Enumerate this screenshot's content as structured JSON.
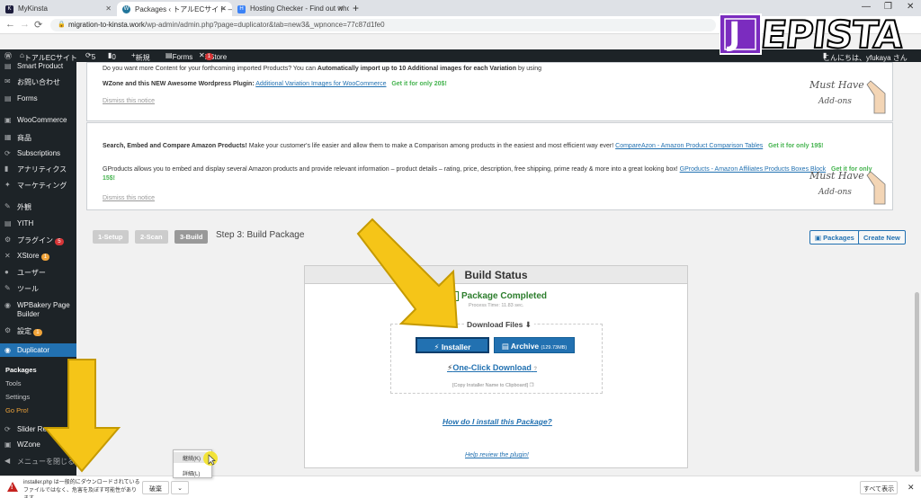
{
  "browser": {
    "tabs": [
      {
        "label": "MyKinsta",
        "fav": "K",
        "fav_color": "#1c1c3c"
      },
      {
        "label": "Packages ‹ トアルECサイト — Wor",
        "fav": "W",
        "fav_color": "#21759b"
      },
      {
        "label": "Hosting Checker - Find out who",
        "fav": "H",
        "fav_color": "#3b82f6"
      }
    ],
    "url_host": "migration-to-kinsta.work",
    "url_path": "/wp-admin/admin.php?page=duplicator&tab=new3&_wpnonce=77c87d1fe0"
  },
  "adminbar": {
    "site": "トアルECサイト",
    "updates": "5",
    "comments": "0",
    "new": "新規",
    "forms": "Forms",
    "xstore": "XStore",
    "xstore_badge": "1",
    "greeting": "こんにちは、yfukaya さん"
  },
  "sidebar": {
    "items": [
      {
        "label": "Smart Product",
        "icon": "▤"
      },
      {
        "label": "お問い合わせ",
        "icon": "✉"
      },
      {
        "label": "Forms",
        "icon": "▤"
      },
      {
        "label": "WooCommerce",
        "icon": "▣"
      },
      {
        "label": "商品",
        "icon": "▦"
      },
      {
        "label": "Subscriptions",
        "icon": "⟳"
      },
      {
        "label": "アナリティクス",
        "icon": "▮"
      },
      {
        "label": "マーケティング",
        "icon": "✦"
      },
      {
        "label": "外観",
        "icon": "✎"
      },
      {
        "label": "YITH",
        "icon": "▤"
      },
      {
        "label": "プラグイン",
        "icon": "⚙",
        "badge": "5"
      },
      {
        "label": "XStore",
        "icon": "✕",
        "badge": "1"
      },
      {
        "label": "ユーザー",
        "icon": "●"
      },
      {
        "label": "ツール",
        "icon": "✎"
      },
      {
        "label": "WPBakery Page",
        "icon": "◉"
      },
      {
        "label": "Builder",
        "icon": ""
      },
      {
        "label": "設定",
        "icon": "⚙",
        "badge": "1"
      },
      {
        "label": "Duplicator",
        "icon": "◉"
      }
    ],
    "sub": [
      "Packages",
      "Tools",
      "Settings",
      "Go Pro!"
    ],
    "bottom": [
      {
        "label": "Slider Revo",
        "icon": "⟳"
      },
      {
        "label": "WZone",
        "icon": "▣"
      },
      {
        "label": "メニューを閉じる",
        "icon": "◀"
      }
    ]
  },
  "notice1": {
    "line1": "Do you want more Content for your forthcoming imported Products? You can",
    "line1_bold": "Automatically import up to 10 Additional images for each Variation",
    "line1_end": "by using",
    "line2_start": "WZone and this NEW Awesome Wordpress Plugin:",
    "line2_link": "Additional Variation Images for WooCommerce",
    "line2_price": "Get it for only 20$!",
    "dismiss": "Dismiss this notice"
  },
  "notice2": {
    "p1_bold": "Search, Embed and Compare Amazon Products!",
    "p1_text": "Make your customer's life easier and allow them to make a Comparison among products in the easiest and most efficient way ever!",
    "p1_link": "CompareAzon - Amazon Product Comparison Tables",
    "p1_price": "Get it for only 19$!",
    "p2_text": "GProducts allows you to embed and display several Amazon products and provide relevant information – product details – rating, price, description, free shipping, prime ready & more into a great looking box!",
    "p2_link": "GProducts - Amazon Affiliates Products Boxes Block",
    "p2_price": "Get it for only",
    "p2_price2": "15$!",
    "dismiss": "Dismiss this notice"
  },
  "musthave": {
    "line1": "Must Have",
    "line2": "Add-ons"
  },
  "steps": {
    "s1": "1-Setup",
    "s2": "2-Scan",
    "s3": "3-Build",
    "title": "Step 3: Build Package",
    "packages_btn": "Packages",
    "create_btn": "Create New"
  },
  "build": {
    "header": "Build Status",
    "completed": "Package Completed",
    "process_time": "Process Time: 11.83 sec.",
    "download_files": "Download Files",
    "installer": "Installer",
    "archive": "Archive",
    "archive_size": "(129.73MB)",
    "one_click": "One-Click Download",
    "copy_installer": "[Copy Installer Name to Clipboard]",
    "how_install": "How do I install this Package?",
    "help_review": "Help review the plugin!"
  },
  "shelf": {
    "warning": "installer.php は一般的にダウンロードされているファイルではなく、危害を及ぼす可能性があります。",
    "discard": "破棄",
    "show_all": "すべて表示"
  },
  "popup": {
    "keep": "継続(K)",
    "details": "詳細(L)"
  },
  "logo": {
    "text": "JEPISTA"
  },
  "colors": {
    "wp_dark": "#1d2327",
    "wp_blue": "#2271b1",
    "arrow_yellow": "#f5c518",
    "logo_purple": "#7b2cbf"
  }
}
